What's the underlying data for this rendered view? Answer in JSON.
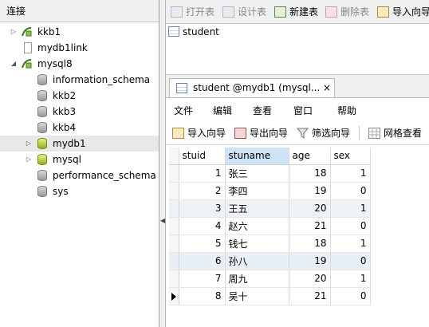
{
  "left_panel": {
    "header": "连接",
    "tree": [
      {
        "label": "kkb1",
        "kind": "conn",
        "expanded": false
      },
      {
        "label": "mydb1link",
        "kind": "file"
      },
      {
        "label": "mysql8",
        "kind": "conn",
        "expanded": true
      },
      {
        "label": "information_schema",
        "kind": "db"
      },
      {
        "label": "kkb2",
        "kind": "db"
      },
      {
        "label": "kkb3",
        "kind": "db"
      },
      {
        "label": "kkb4",
        "kind": "db"
      },
      {
        "label": "mydb1",
        "kind": "db-active",
        "selected": true
      },
      {
        "label": "mysql",
        "kind": "db-active"
      },
      {
        "label": "performance_schema",
        "kind": "db"
      },
      {
        "label": "sys",
        "kind": "db"
      }
    ]
  },
  "toolbar": {
    "open_table": "打开表",
    "design_table": "设计表",
    "new_table": "新建表",
    "delete_table": "删除表",
    "import_wizard": "导入向导"
  },
  "objects": {
    "items": [
      "student"
    ]
  },
  "tab": {
    "title": "student @mydb1 (mysql...",
    "close": "×"
  },
  "menu": {
    "file": "文件",
    "edit": "编辑",
    "view": "查看",
    "window": "窗口",
    "help": "帮助"
  },
  "table_toolbar": {
    "import": "导入向导",
    "export": "导出向导",
    "filter": "筛选向导",
    "grid_view": "网格查看"
  },
  "grid": {
    "columns": [
      "stuid",
      "stuname",
      "age",
      "sex"
    ],
    "rows": [
      [
        "1",
        "张三",
        "18",
        "1"
      ],
      [
        "2",
        "李四",
        "19",
        "0"
      ],
      [
        "3",
        "王五",
        "20",
        "1"
      ],
      [
        "4",
        "赵六",
        "21",
        "0"
      ],
      [
        "5",
        "钱七",
        "18",
        "1"
      ],
      [
        "6",
        "孙八",
        "19",
        "0"
      ],
      [
        "7",
        "周九",
        "20",
        "1"
      ],
      [
        "8",
        "吴十",
        "21",
        "0"
      ]
    ]
  },
  "colors": {
    "selected_header": "#cfe3f6",
    "db_active": "#8fb21d"
  }
}
